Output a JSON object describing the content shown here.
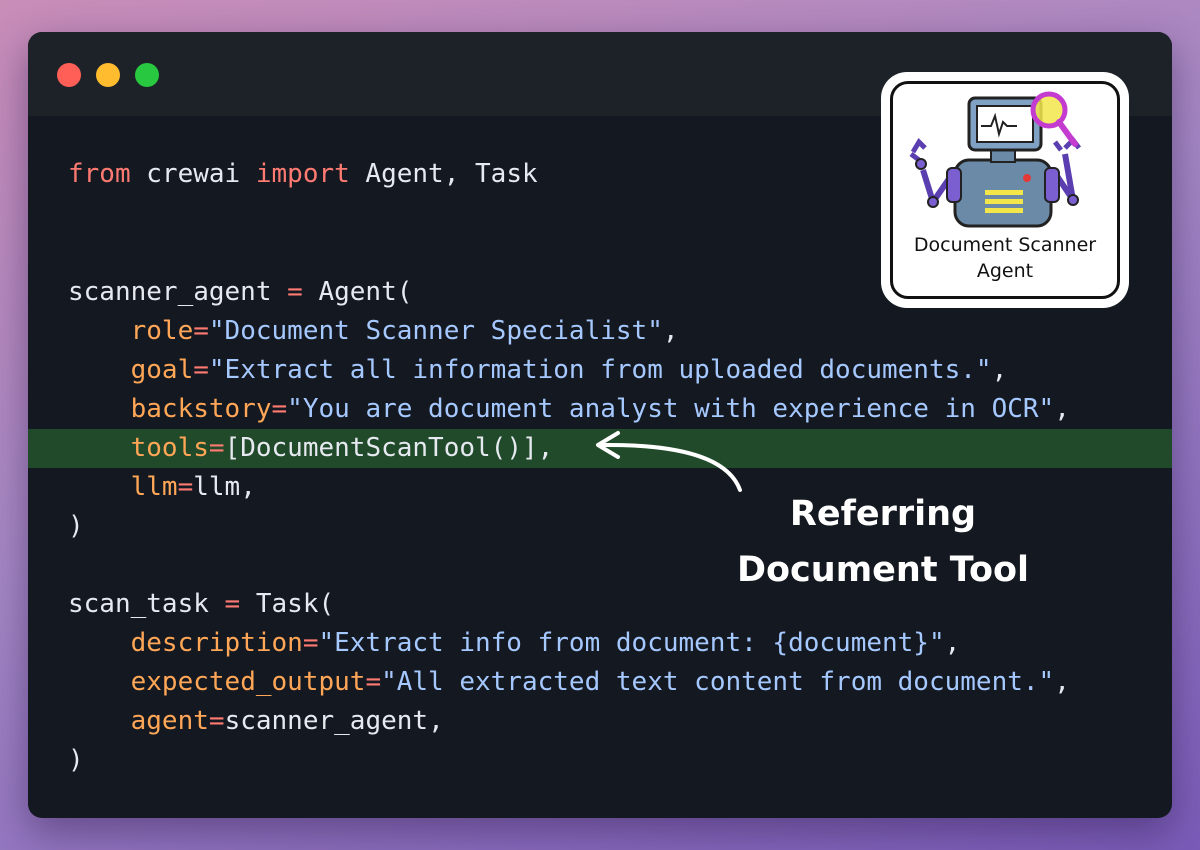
{
  "window": {
    "title_dots": [
      "close",
      "minimize",
      "maximize"
    ]
  },
  "code": {
    "line1": {
      "kw1": "from",
      "mod": " crewai ",
      "kw2": "import",
      "rest": " Agent, Task"
    },
    "line2": {
      "name": "scanner_agent ",
      "eq": "=",
      "rest": " Agent("
    },
    "line3": {
      "indent": "    ",
      "param": "role",
      "eq": "=",
      "val": "\"Document Scanner Specialist\"",
      "tail": ","
    },
    "line4": {
      "indent": "    ",
      "param": "goal",
      "eq": "=",
      "val": "\"Extract all information from uploaded documents.\"",
      "tail": ","
    },
    "line5": {
      "indent": "    ",
      "param": "backstory",
      "eq": "=",
      "val": "\"You are document analyst with experience in OCR\"",
      "tail": ","
    },
    "line6": {
      "indent": "    ",
      "param": "tools",
      "eq": "=",
      "val": "[DocumentScanTool()]",
      "tail": ","
    },
    "line7": {
      "indent": "    ",
      "param": "llm",
      "eq": "=",
      "val": "llm",
      "tail": ","
    },
    "line8": {
      "text": ")"
    },
    "line9": {
      "name": "scan_task ",
      "eq": "=",
      "rest": " Task("
    },
    "line10": {
      "indent": "    ",
      "param": "description",
      "eq": "=",
      "val": "\"Extract info from document: ",
      "brace": "{document}",
      "val2": "\"",
      "tail": ","
    },
    "line11": {
      "indent": "    ",
      "param": "expected_output",
      "eq": "=",
      "val": "\"All extracted text content from document.\"",
      "tail": ","
    },
    "line12": {
      "indent": "    ",
      "param": "agent",
      "eq": "=",
      "val": "scanner_agent",
      "tail": ","
    },
    "line13": {
      "text": ")"
    }
  },
  "logo": {
    "line1": "Document Scanner",
    "line2": "Agent",
    "icon": "robot-with-magnifier-icon"
  },
  "annotation": {
    "line1": "Referring",
    "line2": "Document Tool"
  },
  "colors": {
    "keyword": "#ff7b72",
    "param": "#ffa657",
    "string": "#a5c8ff",
    "highlight": "#214a2a",
    "background": "#141820"
  }
}
